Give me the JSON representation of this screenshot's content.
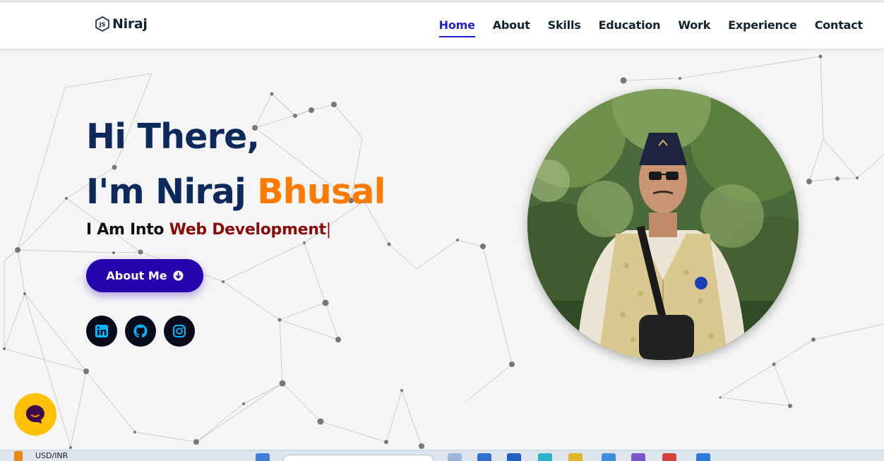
{
  "brand": {
    "name": "Niraj",
    "logo_icon": "js-hexagon-icon"
  },
  "nav": {
    "items": [
      {
        "label": "Home",
        "active": true
      },
      {
        "label": "About",
        "active": false
      },
      {
        "label": "Skills",
        "active": false
      },
      {
        "label": "Education",
        "active": false
      },
      {
        "label": "Work",
        "active": false
      },
      {
        "label": "Experience",
        "active": false
      },
      {
        "label": "Contact",
        "active": false
      }
    ]
  },
  "hero": {
    "line1": "Hi There,",
    "line2_prefix": "I'm Niraj ",
    "line2_accent": "Bhusal",
    "subtitle_prefix": "I Am Into ",
    "subtitle_typed": "Web Development",
    "cursor": "|",
    "about_button": "About Me"
  },
  "socials": [
    {
      "icon": "linkedin-icon"
    },
    {
      "icon": "github-icon"
    },
    {
      "icon": "instagram-icon"
    }
  ],
  "taskbar": {
    "ticker_label": "USD/INR"
  },
  "colors": {
    "accent_blue": "#2506ad",
    "nav_active": "#1f1fd6",
    "title": "#0e2a5c",
    "accent_orange": "#ff7a00",
    "typed_text": "#8b0a0a",
    "social_icon": "#00b7ff",
    "chat_bubble": "#ffc107"
  }
}
